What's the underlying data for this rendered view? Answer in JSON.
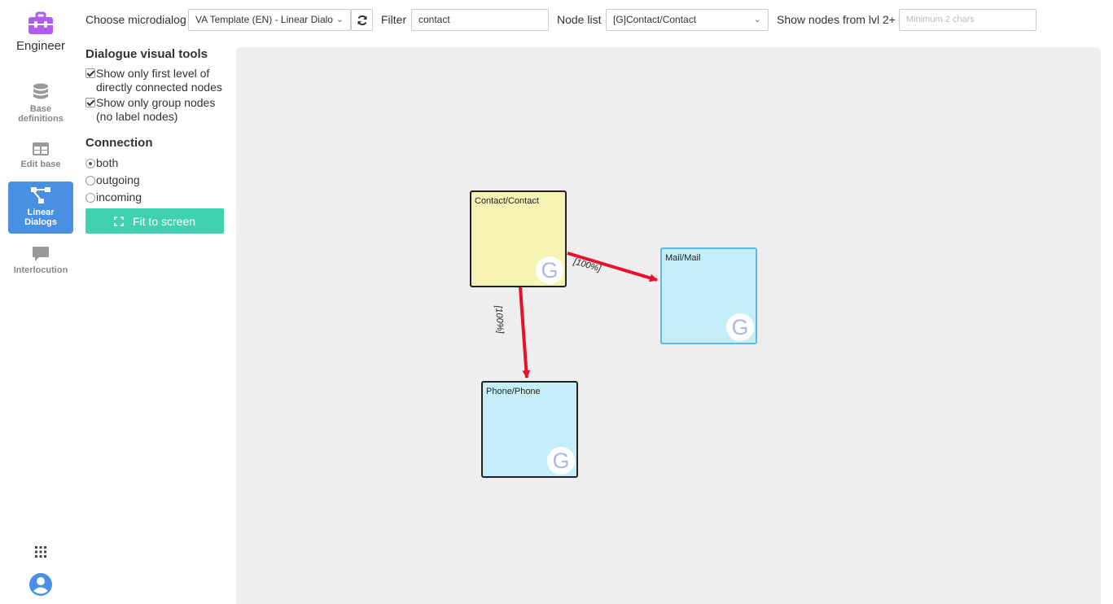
{
  "app": {
    "brand_label": "Engineer",
    "brand_color": "#b05cf0",
    "accent": "#4a90e2",
    "fit_color": "#3fd1b0"
  },
  "sidebar": {
    "items": [
      {
        "label_line1": "Base",
        "label_line2": "definitions",
        "icon": "database-icon",
        "active": false
      },
      {
        "label_line1": "Edit base",
        "label_line2": "",
        "icon": "table-icon",
        "active": false
      },
      {
        "label_line1": "Linear",
        "label_line2": "Dialogs",
        "icon": "flow-icon",
        "active": true
      },
      {
        "label_line1": "Interlocution",
        "label_line2": "",
        "icon": "chat-icon",
        "active": false
      }
    ]
  },
  "toolbar": {
    "microdialog_label": "Choose microdialog",
    "microdialog_value": "VA Template (EN) - Linear Dialo",
    "filter_label": "Filter",
    "filter_value": "contact",
    "nodelist_label": "Node list",
    "nodelist_value": "[G]Contact/Contact",
    "shownodes_label": "Show nodes from lvl 2+",
    "shownodes_placeholder": "Minimum 2 chars"
  },
  "tools": {
    "visual_heading": "Dialogue visual tools",
    "chk_first_level": "Show only first level of directly connected nodes",
    "chk_first_level_checked": true,
    "chk_group_nodes": "Show only group nodes (no label nodes)",
    "chk_group_nodes_checked": true,
    "connection_heading": "Connection",
    "radio_options": [
      "both",
      "outgoing",
      "incoming"
    ],
    "radio_selected": "both",
    "fit_button": "Fit to screen"
  },
  "graph": {
    "nodes": [
      {
        "id": "contact",
        "label": "Contact/Contact",
        "badge": "G",
        "color": "#f7f3b2"
      },
      {
        "id": "mail",
        "label": "Mail/Mail",
        "badge": "G",
        "color": "#c5eff8"
      },
      {
        "id": "phone",
        "label": "Phone/Phone",
        "badge": "G",
        "color": "#c5eff8"
      }
    ],
    "edges": [
      {
        "from": "contact",
        "to": "mail",
        "label": "[100%]"
      },
      {
        "from": "contact",
        "to": "phone",
        "label": "[100%]"
      }
    ],
    "edge_color": "#e8112d"
  }
}
